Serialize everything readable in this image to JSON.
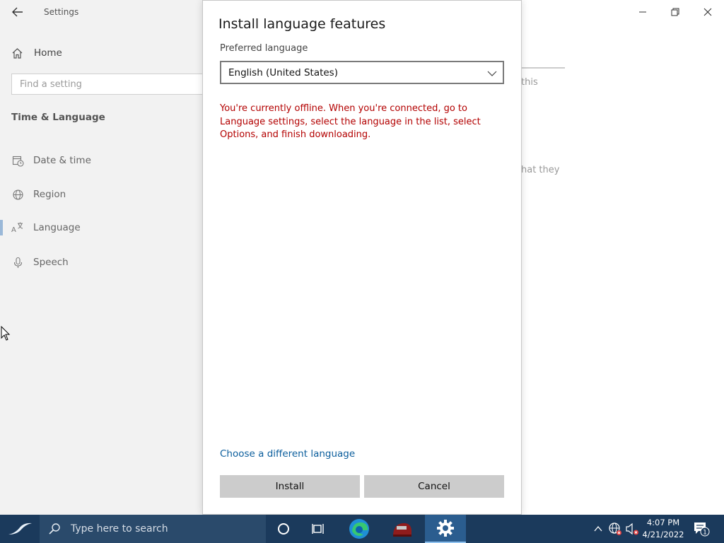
{
  "settings": {
    "app_title": "Settings",
    "home_label": "Home",
    "search_placeholder": "Find a setting",
    "section_title": "Time & Language",
    "nav_items": [
      {
        "label": "Date & time",
        "icon": "calendar-clock-icon"
      },
      {
        "label": "Region",
        "icon": "globe-icon"
      },
      {
        "label": "Language",
        "icon": "language-icon",
        "selected": true
      },
      {
        "label": "Speech",
        "icon": "microphone-icon"
      }
    ],
    "background_fragments": [
      "this",
      "hat they"
    ]
  },
  "dialog": {
    "title": "Install language features",
    "preferred_label": "Preferred language",
    "selected_language": "English (United States)",
    "offline_message": "You're currently offline. When you're connected, go to Language settings, select the language in the list, select Options, and finish downloading.",
    "change_link": "Choose a different language",
    "install_label": "Install",
    "cancel_label": "Cancel",
    "error_color": "#b30000",
    "link_color": "#0a5d9c"
  },
  "taskbar": {
    "search_placeholder": "Type here to search",
    "time": "4:07 PM",
    "date": "4/21/2022",
    "notification_count": "1",
    "background_color": "#1b3a5c"
  }
}
